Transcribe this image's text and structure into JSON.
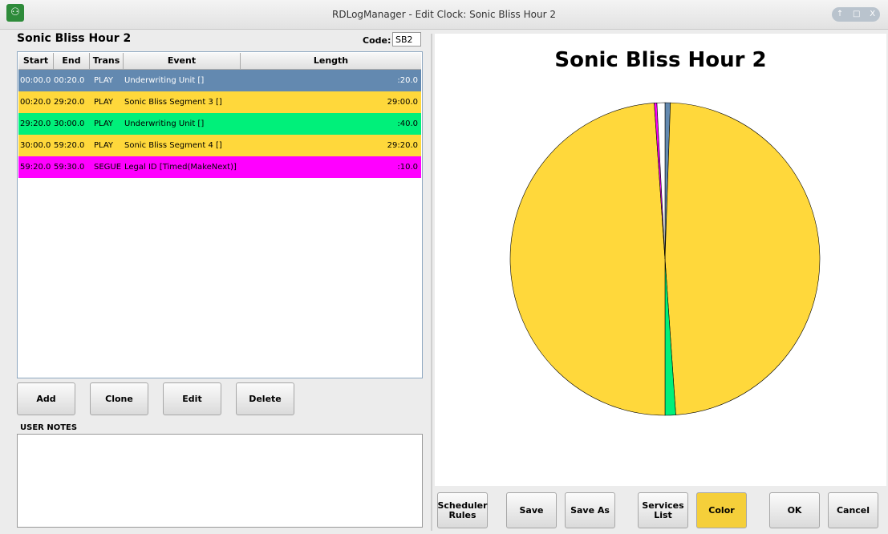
{
  "window": {
    "title": "RDLogManager - Edit Clock: Sonic Bliss Hour 2",
    "controls": [
      "↑",
      "□",
      "X"
    ]
  },
  "clock": {
    "name": "Sonic Bliss Hour 2",
    "code_label": "Code:",
    "code_value": "SB2"
  },
  "table": {
    "headers": {
      "start": "Start",
      "end": "End",
      "trans": "Trans",
      "event": "Event",
      "length": "Length"
    },
    "rows": [
      {
        "start": "00:00.0",
        "end": "00:20.0",
        "trans": "PLAY",
        "event": "Underwriting Unit []",
        "length": ":20.0",
        "color": "#6389b0",
        "selected": true
      },
      {
        "start": "00:20.0",
        "end": "29:20.0",
        "trans": "PLAY",
        "event": "Sonic Bliss Segment 3 []",
        "length": "29:00.0",
        "color": "#ffd83b",
        "selected": false
      },
      {
        "start": "29:20.0",
        "end": "30:00.0",
        "trans": "PLAY",
        "event": "Underwriting Unit []",
        "length": ":40.0",
        "color": "#00f07a",
        "selected": false
      },
      {
        "start": "30:00.0",
        "end": "59:20.0",
        "trans": "PLAY",
        "event": "Sonic Bliss Segment 4 []",
        "length": "29:20.0",
        "color": "#ffd83b",
        "selected": false
      },
      {
        "start": "59:20.0",
        "end": "59:30.0",
        "trans": "SEGUE",
        "event": "Legal ID [Timed(MakeNext)]",
        "length": ":10.0",
        "color": "#ff00ff",
        "selected": false
      }
    ]
  },
  "buttons": {
    "add": "Add",
    "clone": "Clone",
    "edit": "Edit",
    "delete": "Delete",
    "scheduler_rules": "Scheduler Rules",
    "save": "Save",
    "save_as": "Save As",
    "services_list": "Services List",
    "color": "Color",
    "ok": "OK",
    "cancel": "Cancel"
  },
  "colors": {
    "color_button": "#f5cf3a"
  },
  "notes": {
    "label": "USER NOTES",
    "text": ""
  },
  "chart_data": {
    "type": "pie",
    "title": "Sonic Bliss Hour 2",
    "start_angle_deg": 0,
    "slices": [
      {
        "seconds": 20,
        "color": "#6389b0"
      },
      {
        "seconds": 1740,
        "color": "#ffd83b"
      },
      {
        "seconds": 40,
        "color": "#00f07a"
      },
      {
        "seconds": 1760,
        "color": "#ffd83b"
      },
      {
        "seconds": 10,
        "color": "#ff00ff"
      },
      {
        "seconds": 30,
        "color": "#ffffff"
      }
    ],
    "total_seconds": 3600
  }
}
